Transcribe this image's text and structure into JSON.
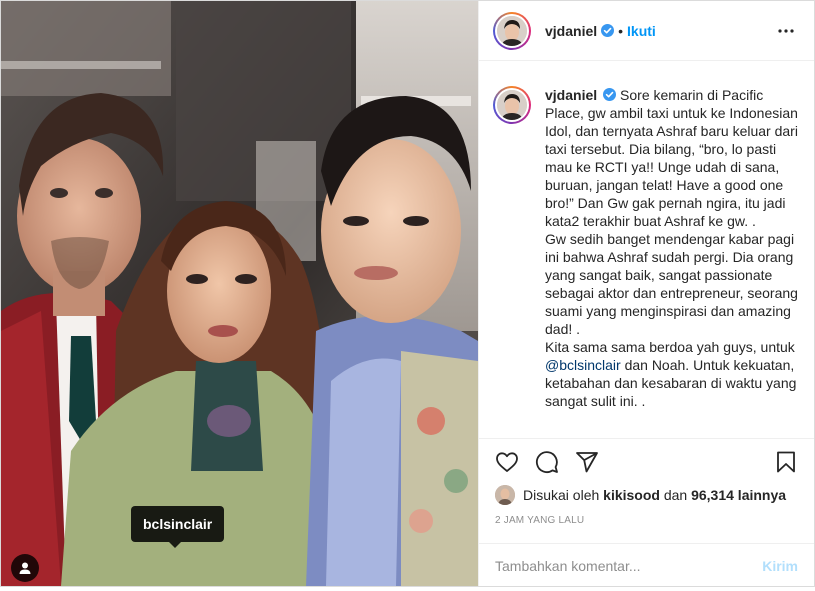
{
  "post": {
    "image": {
      "tag_label": "bclsinclair",
      "icons": {
        "user_tag": "user-icon"
      }
    },
    "header": {
      "username": "vjdaniel",
      "separator": "•",
      "follow_label": "Ikuti",
      "icons": {
        "verified": "verified-badge-icon",
        "more": "more-options-icon"
      }
    },
    "caption": {
      "username": "vjdaniel",
      "text_before_mention": " Sore kemarin di Pacific Place, gw ambil taxi untuk ke Indonesian Idol, dan ternyata Ashraf baru keluar dari taxi tersebut. Dia bilang, “bro, lo pasti mau ke RCTI ya!! Unge udah di sana, buruan, jangan telat! Have a good one bro!” Dan Gw gak pernah ngira, itu jadi kata2 terakhir buat Ashraf ke gw. .\nGw sedih banget mendengar kabar pagi ini bahwa Ashraf sudah pergi. Dia orang yang sangat baik, sangat passionate sebagai aktor dan entrepreneur, seorang suami yang menginspirasi dan amazing dad! .\nKita sama sama berdoa yah guys, untuk ",
      "mention": "@bclsinclair",
      "text_after_mention": " dan Noah. Untuk kekuatan, ketabahan dan kesabaran di waktu yang sangat sulit ini. ."
    },
    "actions": {
      "icons": {
        "like": "heart-icon",
        "comment": "comment-icon",
        "share": "send-icon",
        "save": "bookmark-icon"
      }
    },
    "likes": {
      "prefix": "Disukai oleh ",
      "liker": "kikisood",
      "middle": " dan ",
      "count": "96,314",
      "suffix": " lainnya"
    },
    "timestamp": "2 jam yang lalu",
    "comment": {
      "placeholder": "Tambahkan komentar...",
      "submit_label": "Kirim"
    },
    "colors": {
      "accent": "#0095f6",
      "mention": "#00376b",
      "muted": "#8e8e8e",
      "send_disabled": "#b2dffc"
    }
  }
}
